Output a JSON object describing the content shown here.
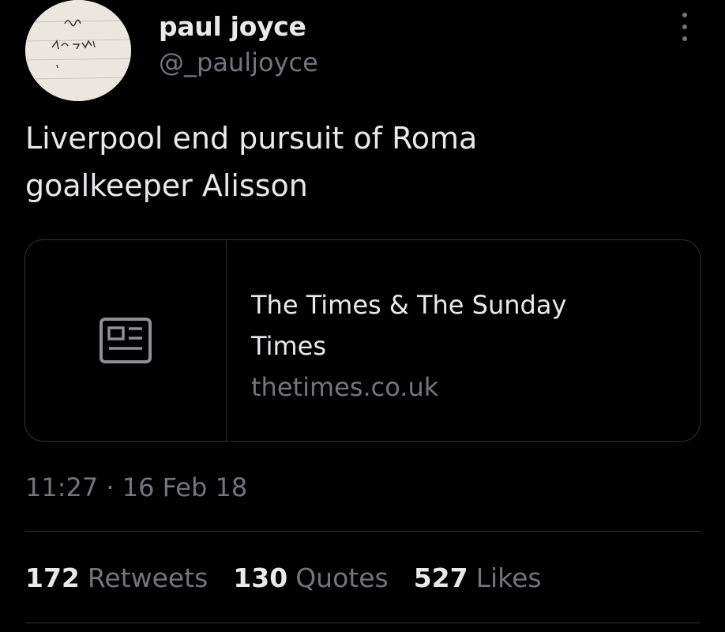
{
  "author": {
    "display_name": "paul joyce",
    "handle": "@_pauljoyce"
  },
  "tweet": {
    "text_line1": "Liverpool end pursuit of Roma",
    "text_line2": "goalkeeper Alisson",
    "timestamp": "11:27 · 16 Feb 18"
  },
  "card": {
    "icon": "article-icon",
    "title_line1": "The Times & The Sunday",
    "title_line2": "Times",
    "domain": "thetimes.co.uk"
  },
  "stats": {
    "retweets_count": "172",
    "retweets_label": "Retweets",
    "quotes_count": "130",
    "quotes_label": "Quotes",
    "likes_count": "527",
    "likes_label": "Likes"
  },
  "colors": {
    "background": "#000000",
    "primary_text": "#e7e9ea",
    "secondary_text": "#71767b",
    "border": "#2f3336"
  }
}
